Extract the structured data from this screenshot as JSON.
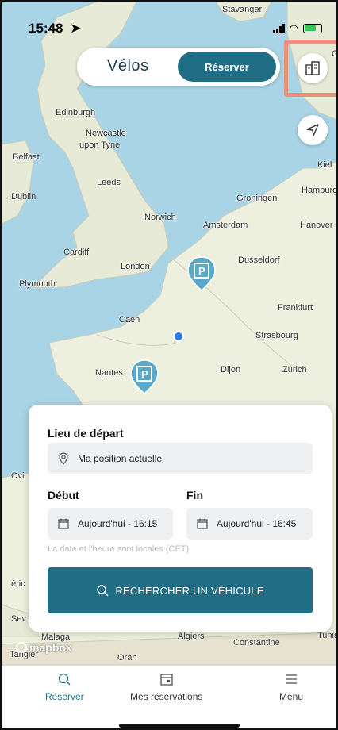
{
  "status": {
    "time": "15:48"
  },
  "header": {
    "mode_label": "Vélos",
    "reserve_label": "Réserver"
  },
  "map": {
    "cities": [
      "Stavanger",
      "Edinburgh",
      "Newcastle",
      "upon Tyne",
      "Belfast",
      "Kiel",
      "Dublin",
      "Leeds",
      "Hamburg",
      "Groningen",
      "Norwich",
      "Amsterdam",
      "Hanover",
      "Cardiff",
      "London",
      "Dusseldorf",
      "Plymouth",
      "Frankfurt",
      "Caen",
      "Strasbourg",
      "Nantes",
      "Dijon",
      "Zurich",
      "Malaga",
      "Algiers",
      "Tunis",
      "Constantine",
      "Tangier",
      "Oran",
      "Ovi",
      "éric",
      "Sev",
      "G"
    ],
    "attribution": "mapbox",
    "pin_label": "P"
  },
  "search": {
    "departure_label": "Lieu de départ",
    "departure_value": "Ma position actuelle",
    "start_label": "Début",
    "start_value": "Aujourd'hui - 16:15",
    "end_label": "Fin",
    "end_value": "Aujourd'hui - 16:45",
    "timezone_hint": "La date et l'heure sont locales (CET)",
    "search_button": "RECHERCHER UN VÉHICULE"
  },
  "tabs": [
    {
      "label": "Réserver",
      "icon": "search-icon",
      "active": true
    },
    {
      "label": "Mes réservations",
      "icon": "calendar-icon",
      "active": false
    },
    {
      "label": "Menu",
      "icon": "menu-icon",
      "active": false
    }
  ],
  "colors": {
    "accent": "#1f6e85",
    "highlight": "#e8907a",
    "location": "#2b7de9"
  }
}
